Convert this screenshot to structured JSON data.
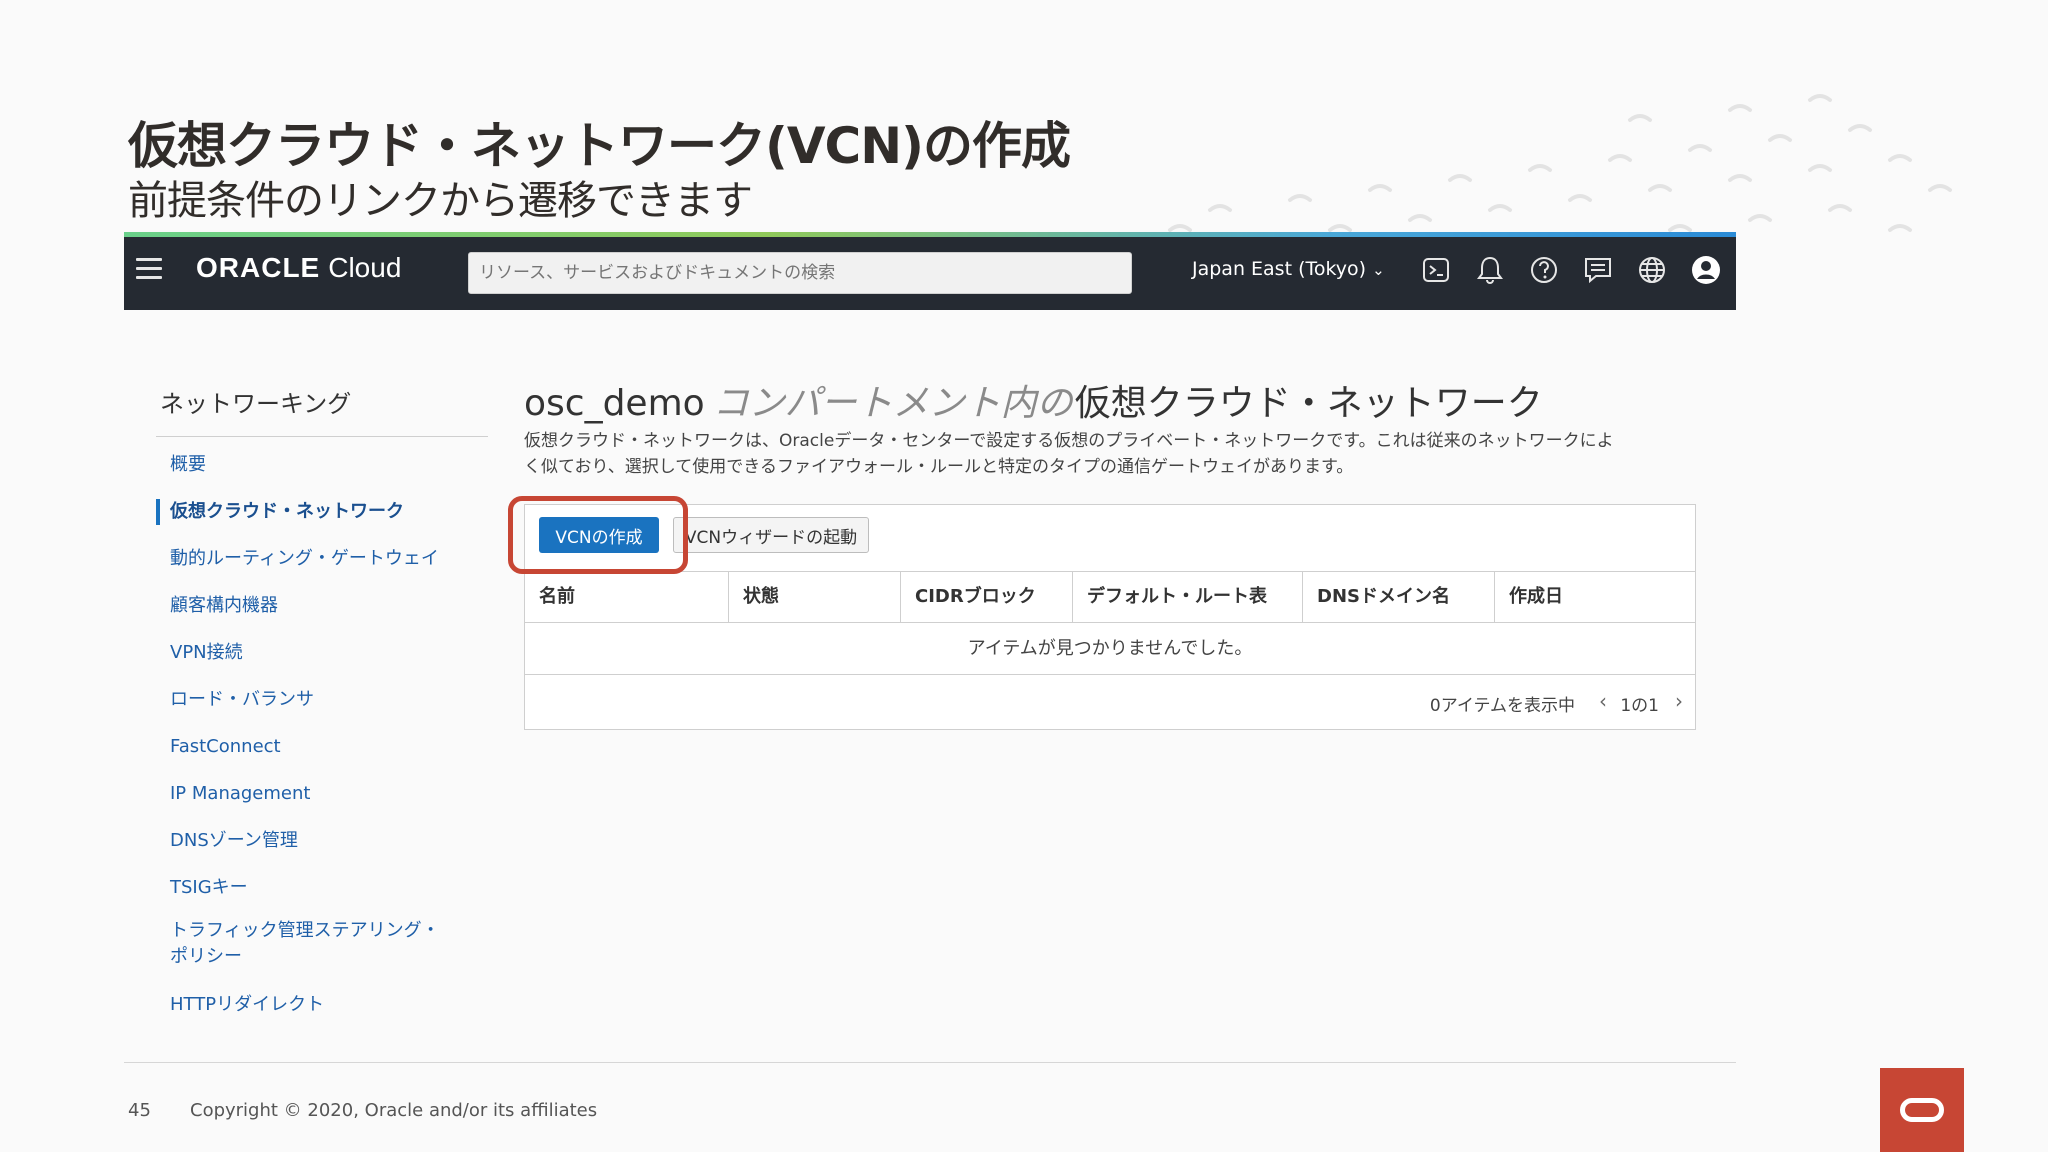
{
  "slide": {
    "title": "仮想クラウド・ネットワーク(VCN)の作成",
    "subtitle": "前提条件のリンクから遷移できます",
    "page_number": "45",
    "copyright": "Copyright © 2020, Oracle and/or its affiliates"
  },
  "topbar": {
    "brand_oracle": "ORACLE",
    "brand_cloud": "Cloud",
    "search_placeholder": "リソース、サービスおよびドキュメントの検索",
    "region": "Japan East (Tokyo)",
    "icons": [
      "cloud-shell-icon",
      "bell-icon",
      "help-icon",
      "chat-icon",
      "globe-icon",
      "profile-icon"
    ]
  },
  "sidebar": {
    "title": "ネットワーキング",
    "items": [
      {
        "label": "概要"
      },
      {
        "label": "仮想クラウド・ネットワーク",
        "active": true
      },
      {
        "label": "動的ルーティング・ゲートウェイ"
      },
      {
        "label": "顧客構内機器"
      },
      {
        "label": "VPN接続"
      },
      {
        "label": "ロード・バランサ"
      },
      {
        "label": "FastConnect"
      },
      {
        "label": "IP Management"
      },
      {
        "label": "DNSゾーン管理"
      },
      {
        "label": "TSIGキー"
      },
      {
        "label": "トラフィック管理ステアリング・ポリシー"
      },
      {
        "label": "HTTPリダイレクト"
      }
    ]
  },
  "main": {
    "title_compartment": "osc_demo",
    "title_middle": "コンパートメント内の",
    "title_suffix": "仮想クラウド・ネットワーク",
    "description_line1": "仮想クラウド・ネットワークは、Oracleデータ・センターで設定する仮想のプライベート・ネットワークです。これは従来のネットワークによ",
    "description_line2": "く似ており、選択して使用できるファイアウォール・ルールと特定のタイプの通信ゲートウェイがあります。",
    "create_button": "VCNの作成",
    "wizard_button": "VCNウィザードの起動",
    "table": {
      "columns": [
        "名前",
        "状態",
        "CIDRブロック",
        "デフォルト・ルート表",
        "DNSドメイン名",
        "作成日"
      ],
      "empty_text": "アイテムが見つかりませんでした。"
    },
    "pager": {
      "count": "0アイテムを表示中",
      "pages": "1の1"
    }
  },
  "colors": {
    "topbar_bg": "#252a32",
    "primary_button": "#1a73c0",
    "highlight": "#c74634",
    "link": "#1f5fa8"
  }
}
